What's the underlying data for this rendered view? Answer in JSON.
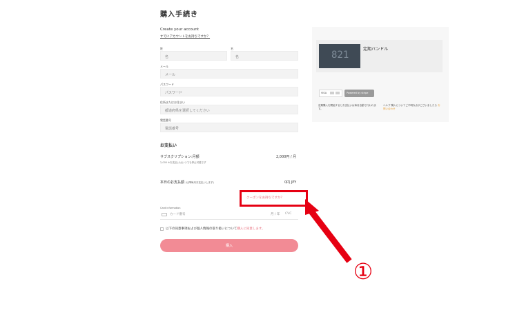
{
  "page_title": "購入手続き",
  "account": {
    "title": "Create your account",
    "link": "すでにアカウントをお持ちですか？"
  },
  "form": {
    "last_name_label": "姓",
    "last_name_placeholder": "名",
    "first_name_label": "名",
    "first_name_placeholder": "名",
    "email_label": "メール",
    "email_placeholder": "メール",
    "password_label": "パスワード",
    "password_placeholder": "パスワード",
    "address_label": "住所またはお住まい",
    "address_placeholder": "都道府県を選択してください",
    "phone_label": "電話番号",
    "phone_placeholder": "電話番号"
  },
  "order": {
    "section_title": "お支払い",
    "item_name": "サブスクリプション:月額",
    "item_sub": "2,000 ※お支払いはいつでも停止可能です",
    "item_price": "2,000円 / 月",
    "total_label": "本日のお支払額",
    "total_sub": "(以降毎月お支払いします)",
    "total_price": "0円 JPY",
    "coupon": "クーポンをお持ちですか？"
  },
  "card": {
    "label": "Card information",
    "number_placeholder": "カード番号",
    "expiry_placeholder": "月 / 年",
    "cvc_placeholder": "CVC"
  },
  "agreement": {
    "text": "以下の同意事項および個人情報の取り扱いについて",
    "link": "購入に同意します。"
  },
  "purchase_button": "購入",
  "summary": {
    "thumb_text": "821",
    "product_name": "定期バンドル",
    "visa": "VISA",
    "powered": "Powered by stripe",
    "note_left": "定期購入を開始するとお支払いは毎月自動で行われます。",
    "note_right": "ヘルプ 購入についてご不明な点がございましたら",
    "note_right_link": "お問い合わせ"
  },
  "annotation": {
    "marker": "①",
    "color": "#e60012"
  },
  "colors": {
    "accent_pink": "#f28b95",
    "link_pink": "#e8707f",
    "annotation_red": "#e60012"
  }
}
